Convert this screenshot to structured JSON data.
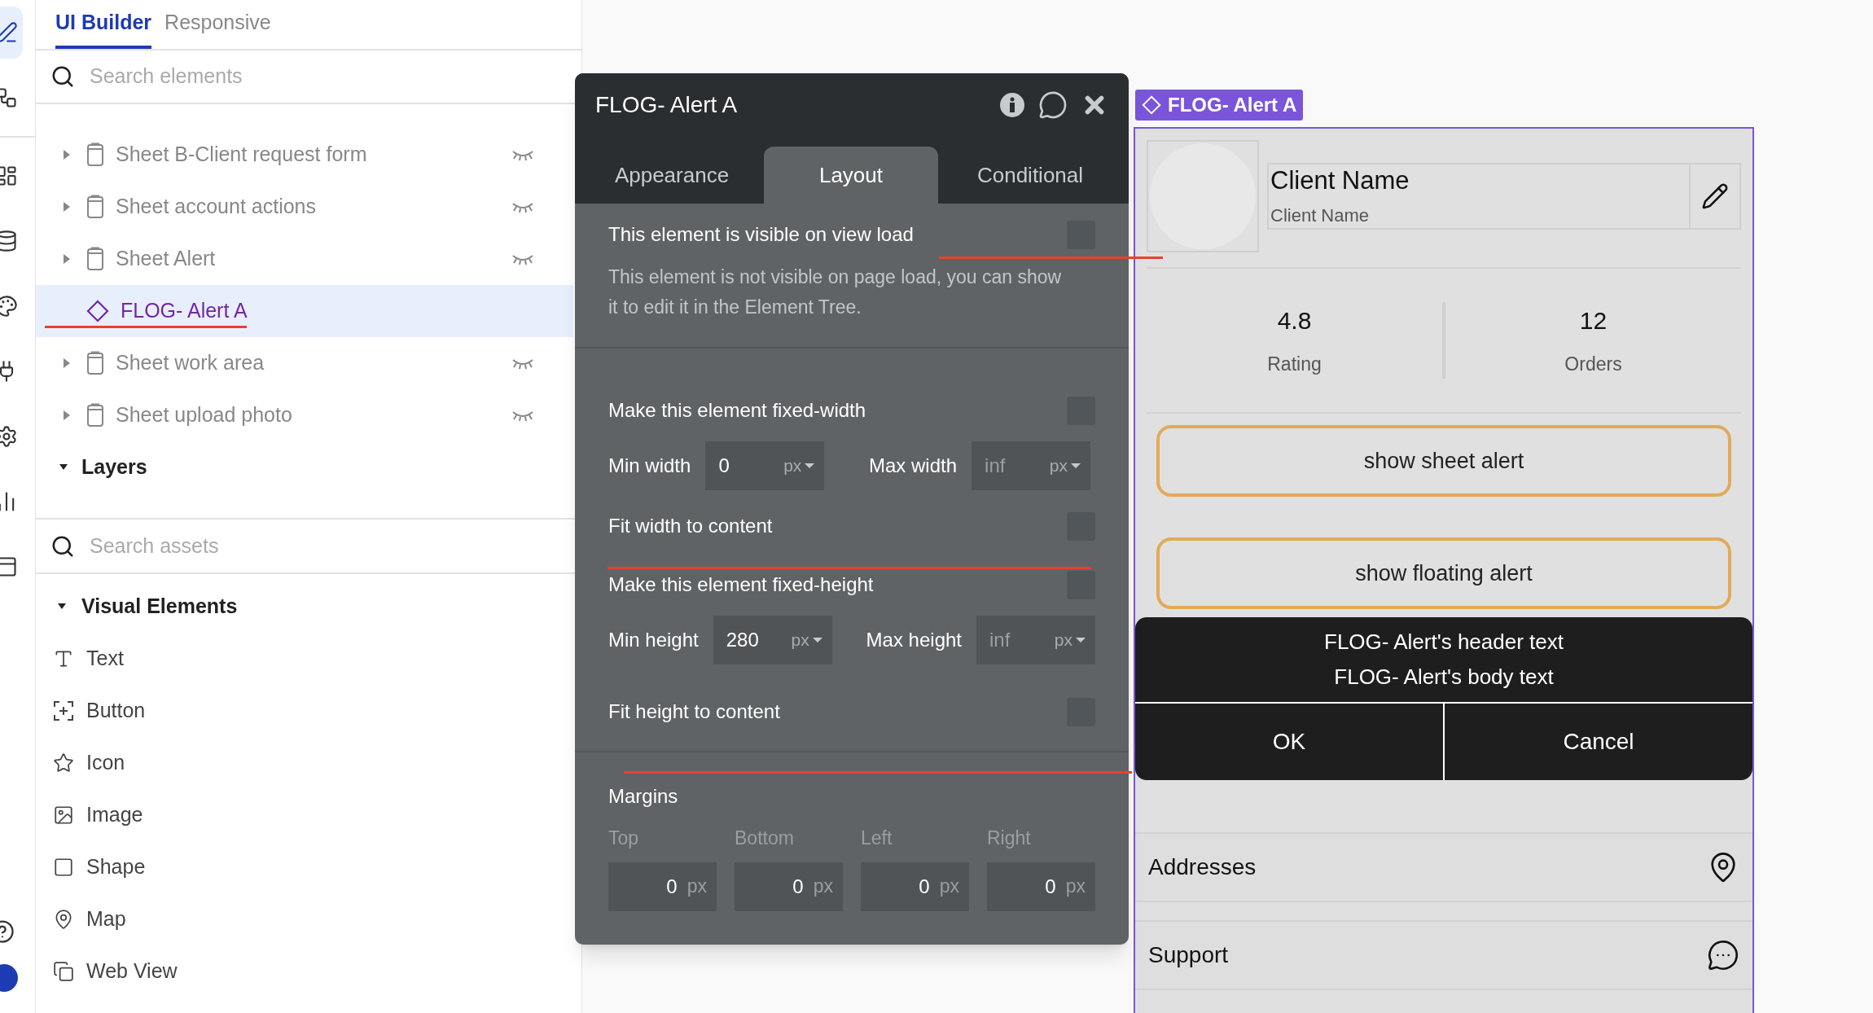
{
  "sidebar": {
    "tabs": [
      {
        "label": "UI Builder",
        "selected": true
      },
      {
        "label": "Responsive",
        "selected": false
      }
    ],
    "element_search": {
      "placeholder": "Search elements"
    },
    "element_tree": [
      {
        "label": "Sheet B-Client request form",
        "kind": "sheet",
        "selected": false,
        "hidden": true
      },
      {
        "label": "Sheet account actions",
        "kind": "sheet",
        "selected": false,
        "hidden": true
      },
      {
        "label": "Sheet Alert",
        "kind": "sheet",
        "selected": false,
        "hidden": true
      },
      {
        "label": "FLOG- Alert A",
        "kind": "reusable",
        "selected": true,
        "hidden": false
      },
      {
        "label": "Sheet work area",
        "kind": "sheet",
        "selected": false,
        "hidden": true
      },
      {
        "label": "Sheet upload photo",
        "kind": "sheet",
        "selected": false,
        "hidden": true
      }
    ],
    "layers": {
      "label": "Layers",
      "expanded": true
    },
    "asset_search": {
      "placeholder": "Search assets"
    },
    "visual_elements": {
      "label": "Visual Elements",
      "expanded": true,
      "items": [
        {
          "label": "Text",
          "kind": "text"
        },
        {
          "label": "Button",
          "kind": "button"
        },
        {
          "label": "Icon",
          "kind": "icon"
        },
        {
          "label": "Image",
          "kind": "image"
        },
        {
          "label": "Shape",
          "kind": "shape"
        },
        {
          "label": "Map",
          "kind": "map"
        },
        {
          "label": "Web View",
          "kind": "webview"
        }
      ]
    }
  },
  "editor": {
    "title": "FLOG- Alert A",
    "tabs": [
      {
        "label": "Appearance",
        "selected": false
      },
      {
        "label": "Layout",
        "selected": true
      },
      {
        "label": "Conditional",
        "selected": false
      }
    ],
    "visible_on_load": {
      "label": "This element is visible on view load",
      "checked": false
    },
    "note": "This element is not visible on page load, you can show it to edit it in the Element Tree.",
    "fixed_width": {
      "label": "Make this element fixed-width",
      "checked": false
    },
    "width_fields": [
      {
        "label": "Min width",
        "value": "0",
        "unit": "px"
      },
      {
        "label": "Max width",
        "placeholder": "inf",
        "unit": "px"
      }
    ],
    "fit_width": {
      "label": "Fit width to content",
      "checked": false
    },
    "fixed_height": {
      "label": "Make this element fixed-height",
      "checked": false
    },
    "height_fields": [
      {
        "label": "Min height",
        "value": "280",
        "unit": "px"
      },
      {
        "label": "Max height",
        "placeholder": "inf",
        "unit": "px"
      }
    ],
    "fit_height": {
      "label": "Fit height to content",
      "checked": false
    },
    "margins": {
      "label": "Margins",
      "fields": [
        {
          "label": "Top",
          "value": "0",
          "unit": "px"
        },
        {
          "label": "Bottom",
          "value": "0",
          "unit": "px"
        },
        {
          "label": "Left",
          "value": "0",
          "unit": "px"
        },
        {
          "label": "Right",
          "value": "0",
          "unit": "px"
        }
      ]
    }
  },
  "canvas": {
    "element_badge": "FLOG- Alert A",
    "profile": {
      "name": "Client Name",
      "subtitle": "Client Name"
    },
    "stats": [
      {
        "value": "4.8",
        "label": "Rating"
      },
      {
        "value": "12",
        "label": "Orders"
      }
    ],
    "buttons": [
      "show sheet alert",
      "show floating alert"
    ],
    "alert": {
      "header": "FLOG- Alert's header text",
      "body": "FLOG- Alert's body text",
      "actions": [
        "OK",
        "Cancel"
      ]
    },
    "menu": [
      {
        "label": "Addresses",
        "kind": "location"
      },
      {
        "label": "Support",
        "kind": "chat"
      }
    ]
  }
}
